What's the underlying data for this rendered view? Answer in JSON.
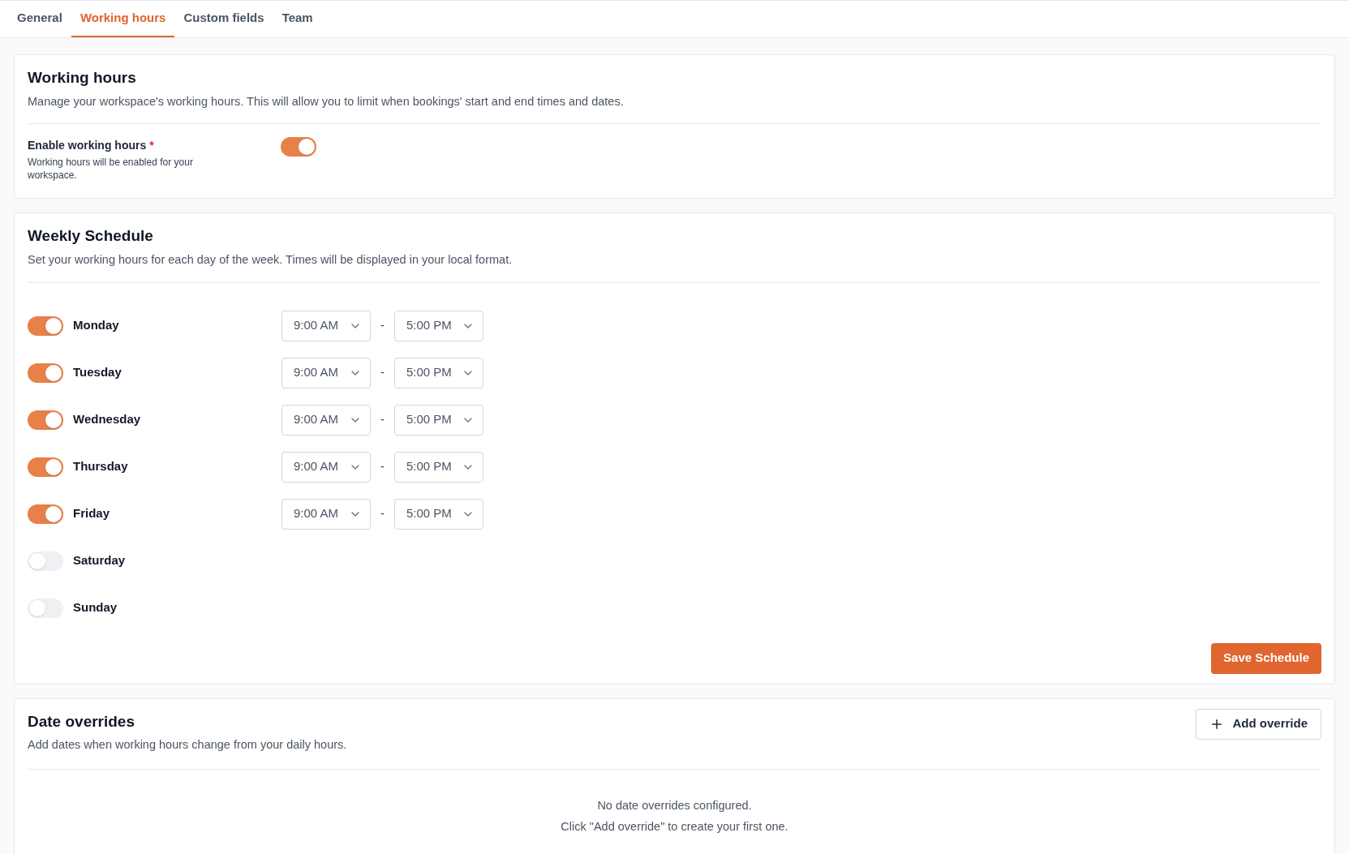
{
  "tabs": [
    {
      "label": "General",
      "selected": false
    },
    {
      "label": "Working hours",
      "selected": true
    },
    {
      "label": "Custom fields",
      "selected": false
    },
    {
      "label": "Team",
      "selected": false
    }
  ],
  "working_hours": {
    "title": "Working hours",
    "description": "Manage your workspace's working hours. This will allow you to limit when bookings' start and end times and dates.",
    "enable": {
      "label": "Enable working hours",
      "required_mark": "*",
      "hint": "Working hours will be enabled for your workspace.",
      "on": true
    }
  },
  "weekly_schedule": {
    "title": "Weekly Schedule",
    "description": "Set your working hours for each day of the week. Times will be displayed in your local format.",
    "separator": "-",
    "days": [
      {
        "name": "Monday",
        "on": true,
        "start": "9:00 AM",
        "end": "5:00 PM"
      },
      {
        "name": "Tuesday",
        "on": true,
        "start": "9:00 AM",
        "end": "5:00 PM"
      },
      {
        "name": "Wednesday",
        "on": true,
        "start": "9:00 AM",
        "end": "5:00 PM"
      },
      {
        "name": "Thursday",
        "on": true,
        "start": "9:00 AM",
        "end": "5:00 PM"
      },
      {
        "name": "Friday",
        "on": true,
        "start": "9:00 AM",
        "end": "5:00 PM"
      },
      {
        "name": "Saturday",
        "on": false
      },
      {
        "name": "Sunday",
        "on": false
      }
    ],
    "save_button": "Save Schedule"
  },
  "date_overrides": {
    "title": "Date overrides",
    "description": "Add dates when working hours change from your daily hours.",
    "add_button": "Add override",
    "empty_lines": [
      "No date overrides configured.",
      "Click \"Add override\" to create your first one."
    ]
  }
}
